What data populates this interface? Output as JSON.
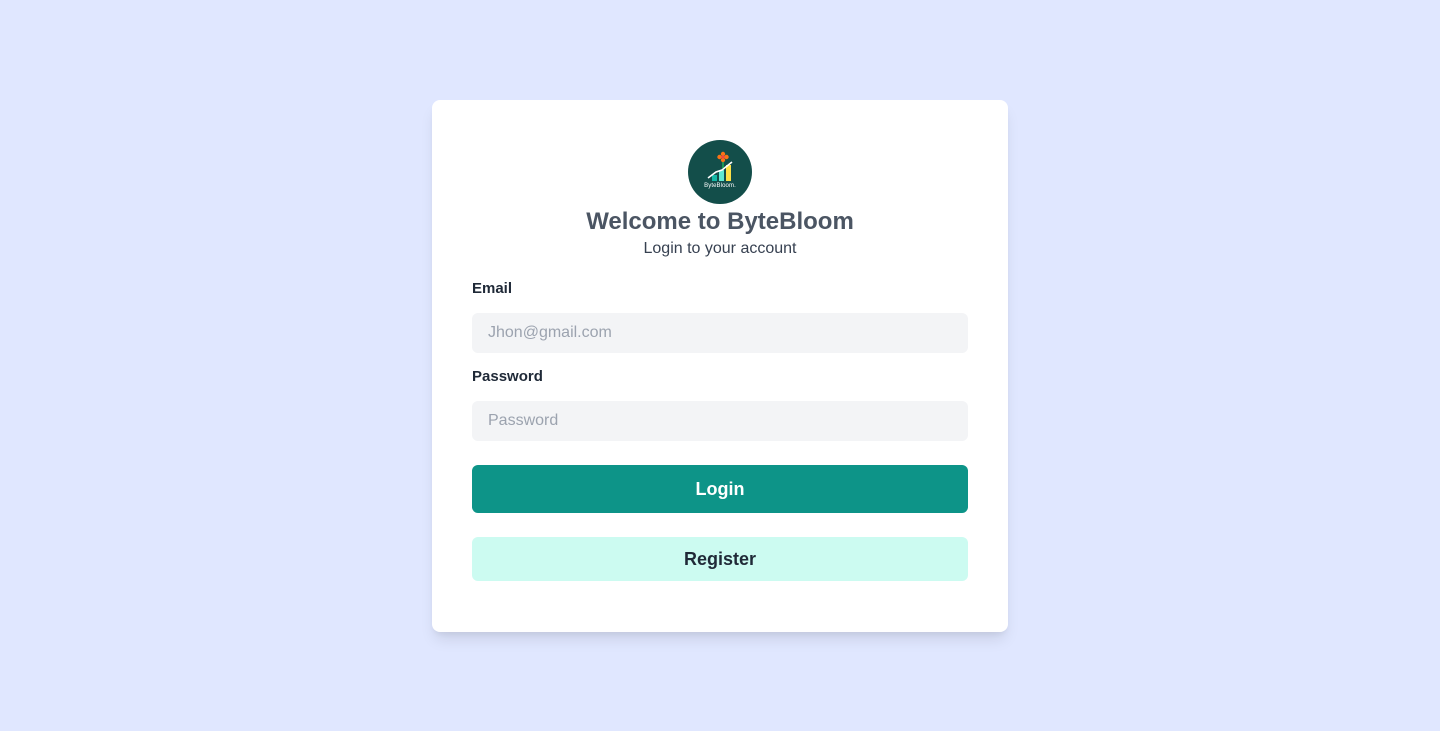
{
  "brand": {
    "logo_text": "ByteBloom."
  },
  "header": {
    "title": "Welcome to ByteBloom",
    "subtitle": "Login to your account"
  },
  "form": {
    "email_label": "Email",
    "email_placeholder": "Jhon@gmail.com",
    "email_value": "",
    "password_label": "Password",
    "password_placeholder": "Password",
    "password_value": ""
  },
  "actions": {
    "login_label": "Login",
    "register_label": "Register"
  },
  "colors": {
    "background": "#e0e7ff",
    "primary": "#0d9488",
    "secondary": "#ccfbf1",
    "logo_bg": "#134e4a"
  }
}
